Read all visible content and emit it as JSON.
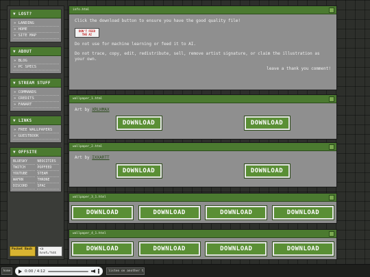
{
  "sidebar": {
    "lost": {
      "title": "▼ LOST?",
      "items": [
        "» LANDING",
        "» HOME",
        "» SITE MAP"
      ]
    },
    "about": {
      "title": "▼ ABOUT",
      "items": [
        "» BLOG",
        "» PC SPECS"
      ]
    },
    "stream": {
      "title": "▼ STREAM STUFF",
      "items": [
        "» COMMANDS",
        "» CREDITS",
        "» FANART"
      ]
    },
    "links": {
      "title": "▼ LINKS",
      "items": [
        "» FREE WALLPAPERS",
        "» GUESTBOOK"
      ]
    },
    "offsite": {
      "title": "▼ OFFSITE",
      "items": [
        "BLUESKY",
        "NEOCITIES",
        "TWITCH",
        "POPFEED",
        "YOUTUBE",
        "STEAM",
        "WAFRN",
        "THRONE",
        "DISCORD",
        "SPAC"
      ]
    },
    "badge_pocket": "Pocket Bash",
    "badge_code": "<a href=\"htt"
  },
  "info": {
    "title": "info.html",
    "line1": "Click the download button to ensure you have the good quality file!",
    "thread_badge": "DON'T FEED THE AI",
    "line2": "Do not use for machine learning or feed it to AI.",
    "line3": "Do not trace, copy, edit, redistribute, sell, remove artist signature, or claim the illustration as your own.",
    "comment": "leave a thank you comment!"
  },
  "wall1": {
    "title": "wallpaper_1.html",
    "artby_prefix": "Art by ",
    "artist": "XRLHMAX",
    "buttons": [
      "DOWNLOAD",
      "DOWNLOAD"
    ]
  },
  "wall2": {
    "title": "wallpaper_2.html",
    "artby_prefix": "Art by ",
    "artist": "IXXARTT",
    "buttons": [
      "DOWNLOAD",
      "DOWNLOAD"
    ]
  },
  "wall3": {
    "title": "wallpaper_3_1.html",
    "buttons": [
      "DOWNLOAD",
      "DOWNLOAD",
      "DOWNLOAD",
      "DOWNLOAD"
    ]
  },
  "wall4": {
    "title": "wallpaper_4_1.html",
    "buttons": [
      "DOWNLOAD",
      "DOWNLOAD",
      "DOWNLOAD",
      "DOWNLOAD"
    ]
  },
  "bottombar": {
    "home": "home",
    "time": "0:00 / 4:12",
    "music_button": "listen on another tab ⤴"
  }
}
